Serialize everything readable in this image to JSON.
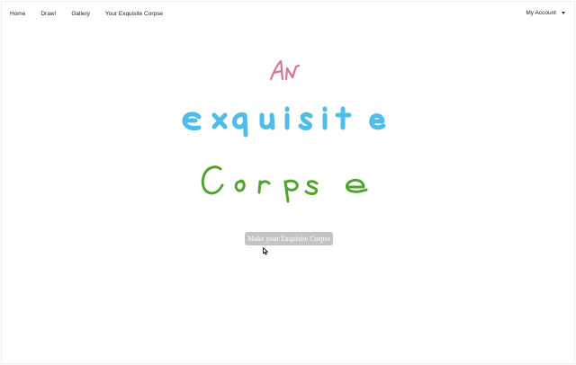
{
  "nav": {
    "links": [
      "Home",
      "Draw!",
      "Gallery",
      "Your Exquisite Corpse"
    ],
    "account_label": "My Account"
  },
  "hero": {
    "line1": "An",
    "line2": "Exquisite",
    "line3": "Corpse",
    "line1_color": "#d9738f",
    "line2_color": "#4fbde8",
    "line3_color": "#4fa52c"
  },
  "cta": {
    "label": "Make your Exquisite Corpse",
    "color": "#c4c4c4"
  }
}
